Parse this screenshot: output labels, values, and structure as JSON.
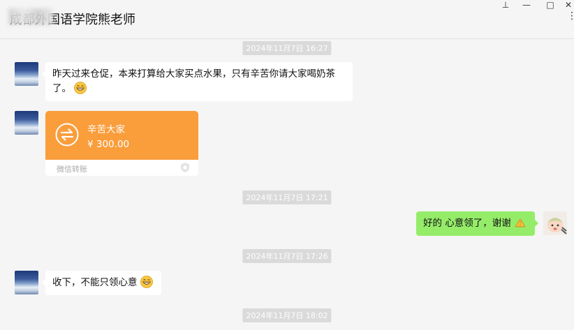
{
  "window": {
    "title": "成都外国语学院熊老师",
    "controls": {
      "pin": "⊥",
      "minimize": "—",
      "maximize": "□",
      "close": "✕",
      "more": "⋮"
    }
  },
  "timestamps": [
    "2024年11月7日 16:27",
    "2024年11月7日 17:21",
    "2024年11月7日 17:26",
    "2024年11月7日 18:02"
  ],
  "messages": [
    {
      "sender": "other",
      "line1": "昨天过来仓促，本来打算给大家买点水果，只有辛苦你请大家喝奶茶",
      "line2": "了。",
      "emoji": "grin-emoji"
    },
    {
      "sender": "other",
      "type": "transfer",
      "note": "辛苦大家",
      "amount": "¥ 300.00",
      "label": "微信转账"
    },
    {
      "sender": "me",
      "text": "好的 心意领了，谢谢",
      "emoji": "hands-emoji"
    },
    {
      "sender": "other",
      "text": "收下，不能只领心意",
      "emoji": "grin-emoji"
    }
  ],
  "colors": {
    "background": "#f5f5f5",
    "my_bubble": "#95ec69",
    "other_bubble": "#ffffff",
    "transfer_orange": "#fa9d3b",
    "timestamp_bg": "#dadada"
  }
}
